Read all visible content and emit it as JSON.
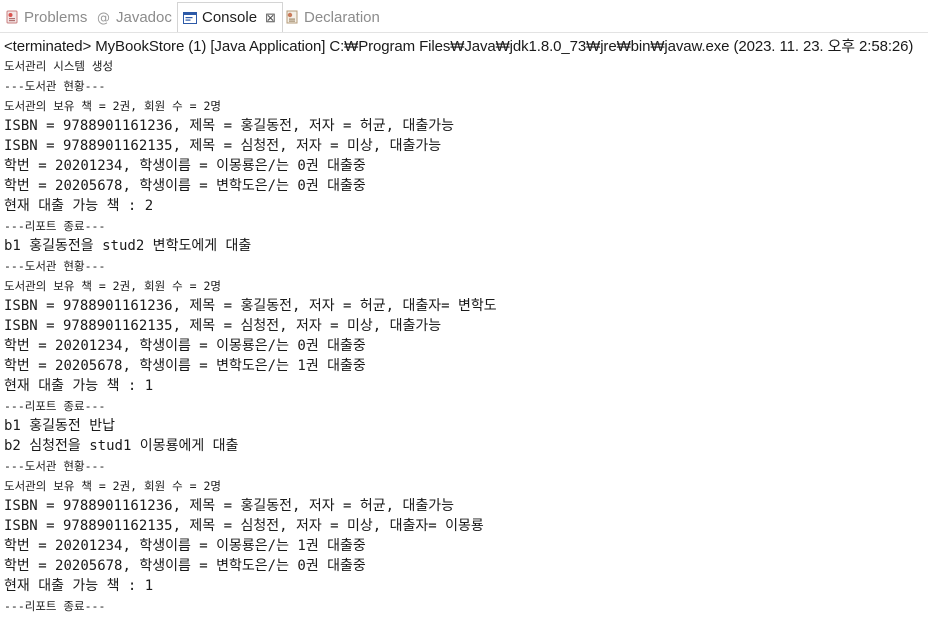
{
  "tabs": [
    {
      "label": "Problems",
      "icon": "problems-icon",
      "active": false
    },
    {
      "label": "Javadoc",
      "icon": "at-sign-icon",
      "active": false
    },
    {
      "label": "Console",
      "icon": "console-icon",
      "active": true
    },
    {
      "label": "Declaration",
      "icon": "declaration-icon",
      "active": false
    }
  ],
  "console": {
    "close_label": "⊠",
    "status": "<terminated> MyBookStore (1) [Java Application] C:₩Program Files₩Java₩jdk1.8.0_73₩jre₩bin₩javaw.exe (2023. 11. 23. 오후 2:58:26)",
    "lines": [
      {
        "text": "도서관리 시스템 생성",
        "size": "small"
      },
      {
        "text": "---도서관 현황---",
        "size": "small"
      },
      {
        "text": "도서관의 보유 책 = 2권, 회원 수 = 2명",
        "size": "small"
      },
      {
        "text": "ISBN = 9788901161236, 제목 = 홍길동전, 저자 = 허균, 대출가능",
        "size": "big"
      },
      {
        "text": "ISBN = 9788901162135, 제목 = 심청전, 저자 = 미상, 대출가능",
        "size": "big"
      },
      {
        "text": "학번 = 20201234, 학생이름 = 이몽룡은/는 0권 대출중",
        "size": "big"
      },
      {
        "text": "학번 = 20205678, 학생이름 = 변학도은/는 0권 대출중",
        "size": "big"
      },
      {
        "text": "현재 대출 가능 책 : 2",
        "size": "big"
      },
      {
        "text": "---리포트 종료---",
        "size": "small"
      },
      {
        "text": "b1 홍길동전을 stud2 변학도에게 대출",
        "size": "big"
      },
      {
        "text": "---도서관 현황---",
        "size": "small"
      },
      {
        "text": "도서관의 보유 책 = 2권, 회원 수 = 2명",
        "size": "small"
      },
      {
        "text": "ISBN = 9788901161236, 제목 = 홍길동전, 저자 = 허균, 대출자= 변학도",
        "size": "big"
      },
      {
        "text": "ISBN = 9788901162135, 제목 = 심청전, 저자 = 미상, 대출가능",
        "size": "big"
      },
      {
        "text": "학번 = 20201234, 학생이름 = 이몽룡은/는 0권 대출중",
        "size": "big"
      },
      {
        "text": "학번 = 20205678, 학생이름 = 변학도은/는 1권 대출중",
        "size": "big"
      },
      {
        "text": "현재 대출 가능 책 : 1",
        "size": "big"
      },
      {
        "text": "---리포트 종료---",
        "size": "small"
      },
      {
        "text": "b1 홍길동전 반납",
        "size": "big"
      },
      {
        "text": "b2 심청전을 stud1 이몽룡에게 대출",
        "size": "big"
      },
      {
        "text": "---도서관 현황---",
        "size": "small"
      },
      {
        "text": "도서관의 보유 책 = 2권, 회원 수 = 2명",
        "size": "small"
      },
      {
        "text": "ISBN = 9788901161236, 제목 = 홍길동전, 저자 = 허균, 대출가능",
        "size": "big"
      },
      {
        "text": "ISBN = 9788901162135, 제목 = 심청전, 저자 = 미상, 대출자= 이몽룡",
        "size": "big"
      },
      {
        "text": "학번 = 20201234, 학생이름 = 이몽룡은/는 1권 대출중",
        "size": "big"
      },
      {
        "text": "학번 = 20205678, 학생이름 = 변학도은/는 0권 대출중",
        "size": "big"
      },
      {
        "text": "현재 대출 가능 책 : 1",
        "size": "big"
      },
      {
        "text": "---리포트 종료---",
        "size": "small"
      }
    ]
  },
  "colors": {
    "active_tab_text": "#1f1f1f",
    "inactive_tab_text": "#8c8c8c",
    "console_text": "#1a1a1a"
  }
}
